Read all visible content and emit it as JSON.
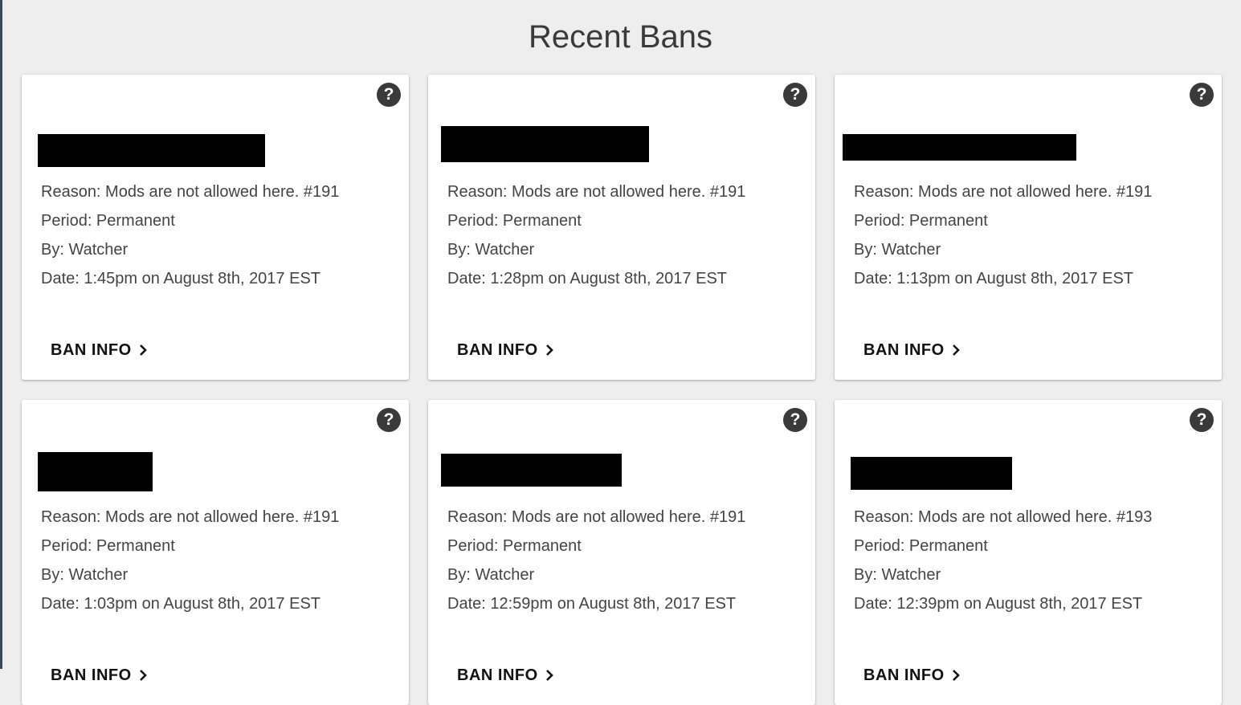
{
  "page": {
    "title": "Recent Bans"
  },
  "colors": {
    "background": "#eeeeee",
    "card": "#ffffff",
    "text": "#444444",
    "icon": "#3a3a3a",
    "redaction": "#000000"
  },
  "labels": {
    "reason_prefix": "Reason: ",
    "period_prefix": "Period: ",
    "by_prefix": "By: ",
    "date_prefix": "Date: ",
    "ban_info_button": "BAN INFO",
    "help_icon_glyph": "?"
  },
  "icons": {
    "help": "question-circle-icon",
    "chevron": "chevron-right-icon"
  },
  "bans": [
    {
      "reason_line": "Reason: Mods are not allowed here. #191",
      "period_line": "Period: Permanent",
      "by_line": "By: Watcher",
      "date_line": "Date: 1:45pm on August 8th, 2017 EST",
      "ban_info": "BAN INFO",
      "help": "?"
    },
    {
      "reason_line": "Reason: Mods are not allowed here. #191",
      "period_line": "Period: Permanent",
      "by_line": "By: Watcher",
      "date_line": "Date: 1:28pm on August 8th, 2017 EST",
      "ban_info": "BAN INFO",
      "help": "?"
    },
    {
      "reason_line": "Reason: Mods are not allowed here. #191",
      "period_line": "Period: Permanent",
      "by_line": "By: Watcher",
      "date_line": "Date: 1:13pm on August 8th, 2017 EST",
      "ban_info": "BAN INFO",
      "help": "?"
    },
    {
      "reason_line": "Reason: Mods are not allowed here. #191",
      "period_line": "Period: Permanent",
      "by_line": "By: Watcher",
      "date_line": "Date: 1:03pm on August 8th, 2017 EST",
      "ban_info": "BAN INFO",
      "help": "?"
    },
    {
      "reason_line": "Reason: Mods are not allowed here. #191",
      "period_line": "Period: Permanent",
      "by_line": "By: Watcher",
      "date_line": "Date: 12:59pm on August 8th, 2017 EST",
      "ban_info": "BAN INFO",
      "help": "?"
    },
    {
      "reason_line": "Reason: Mods are not allowed here. #193",
      "period_line": "Period: Permanent",
      "by_line": "By: Watcher",
      "date_line": "Date: 12:39pm on August 8th, 2017 EST",
      "ban_info": "BAN INFO",
      "help": "?"
    }
  ]
}
